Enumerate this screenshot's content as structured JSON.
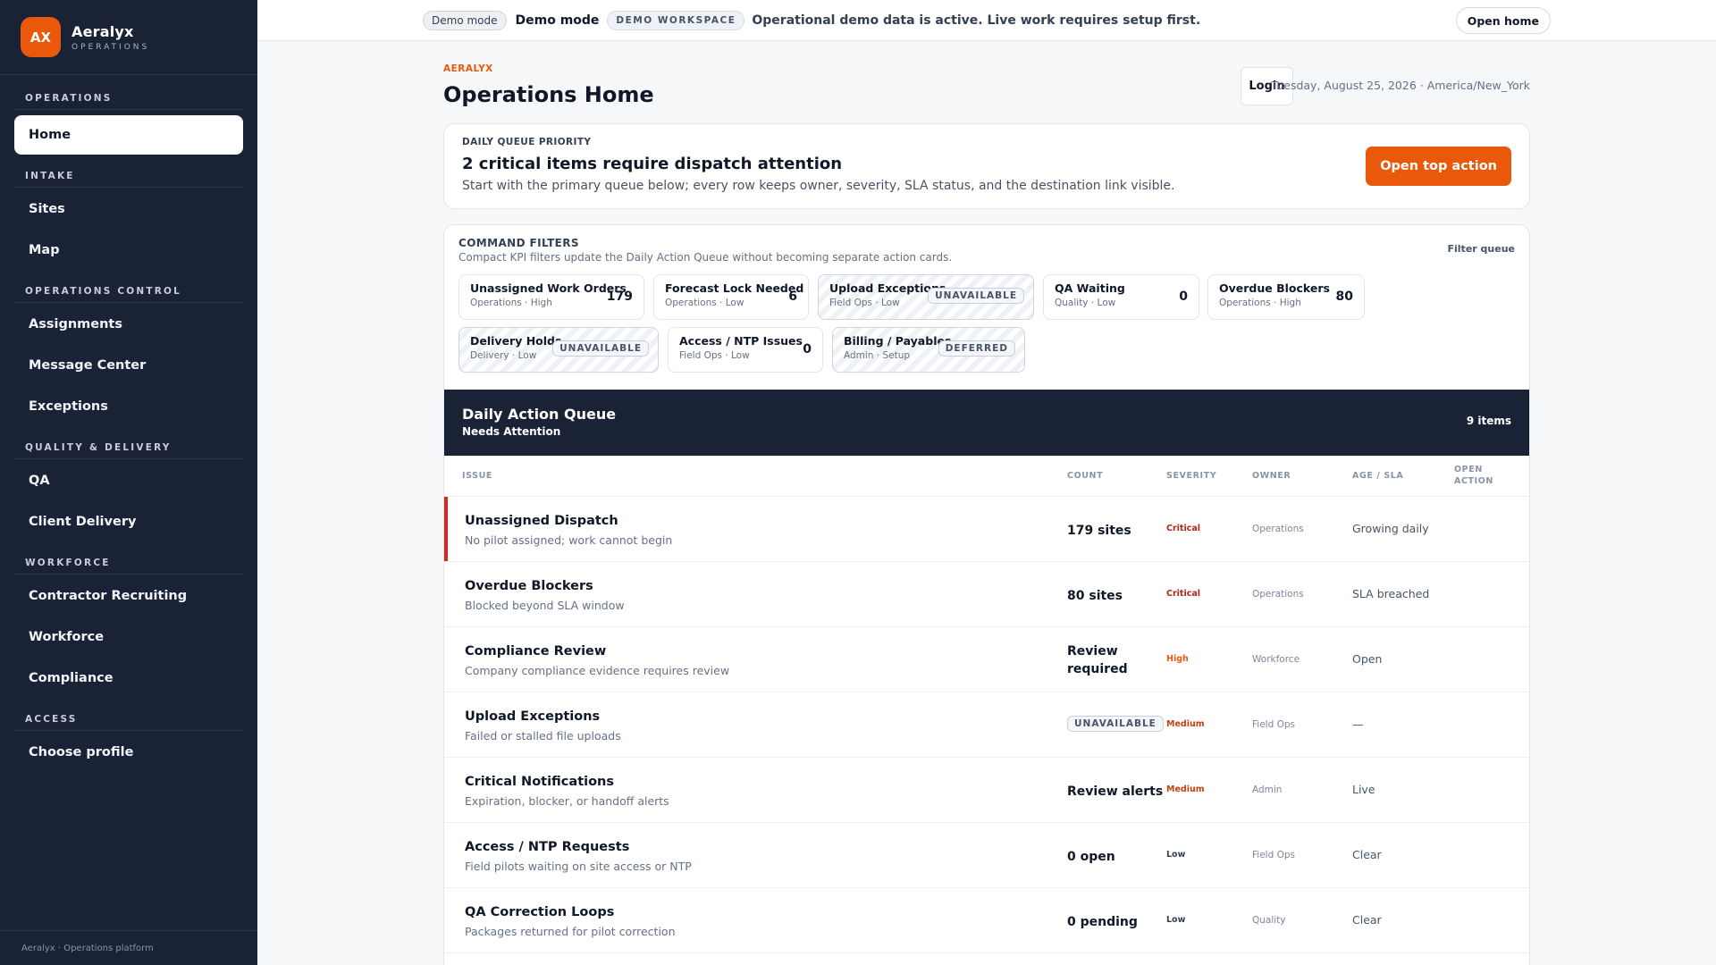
{
  "brand": {
    "logo": "AX",
    "name": "Aeralyx",
    "sub": "OPERATIONS"
  },
  "nav": {
    "operations": {
      "heading": "OPERATIONS",
      "items": [
        "Home"
      ]
    },
    "intake": {
      "heading": "INTAKE",
      "items": [
        "Sites",
        "Map"
      ]
    },
    "ops_control": {
      "heading": "OPERATIONS CONTROL",
      "items": [
        "Assignments",
        "Message Center",
        "Exceptions"
      ]
    },
    "quality": {
      "heading": "QUALITY & DELIVERY",
      "items": [
        "QA",
        "Client Delivery"
      ]
    },
    "workforce": {
      "heading": "WORKFORCE",
      "items": [
        "Contractor Recruiting",
        "Workforce",
        "Compliance"
      ]
    },
    "access": {
      "heading": "ACCESS",
      "items": [
        "Choose profile"
      ]
    },
    "footer": "Aeralyx · Operations platform"
  },
  "topbar": {
    "chip": "Demo mode",
    "title": "Demo mode",
    "workspace": "DEMO WORKSPACE",
    "message": "Operational demo data is active. Live work requires setup first.",
    "open_home": "Open home"
  },
  "header": {
    "eyebrow": "AERALYX",
    "title": "Operations Home",
    "login": "Login",
    "date": "Tuesday, August 25, 2026 · America/New_York"
  },
  "priority": {
    "label": "DAILY QUEUE PRIORITY",
    "title": "2 critical items require dispatch attention",
    "desc": "Start with the primary queue below; every row keeps owner, severity, SLA status, and the destination link visible.",
    "button": "Open top action"
  },
  "filters": {
    "label": "COMMAND FILTERS",
    "desc": "Compact KPI filters update the Daily Action Queue without becoming separate action cards.",
    "link": "Filter queue",
    "kpis": [
      {
        "name": "Unassigned Work Orders",
        "meta": "Operations · High",
        "value": "179"
      },
      {
        "name": "Forecast Lock Needed",
        "meta": "Operations · Low",
        "value": "6"
      },
      {
        "name": "Upload Exceptions",
        "meta": "Field Ops · Low",
        "badge": "UNAVAILABLE"
      },
      {
        "name": "QA Waiting",
        "meta": "Quality · Low",
        "value": "0"
      },
      {
        "name": "Overdue Blockers",
        "meta": "Operations · High",
        "value": "80"
      },
      {
        "name": "Delivery Holds",
        "meta": "Delivery · Low",
        "badge": "UNAVAILABLE"
      },
      {
        "name": "Access / NTP Issues",
        "meta": "Field Ops · Low",
        "value": "0"
      },
      {
        "name": "Billing / Payables",
        "meta": "Admin · Setup",
        "badge": "DEFERRED"
      }
    ]
  },
  "queue": {
    "title": "Daily Action Queue",
    "subtitle": "Needs Attention",
    "count": "9 items",
    "columns": {
      "issue": "ISSUE",
      "count": "COUNT",
      "severity": "SEVERITY",
      "owner": "OWNER",
      "age": "AGE / SLA",
      "open1": "OPEN",
      "open2": "ACTION"
    },
    "rows": [
      {
        "title": "Unassigned Dispatch",
        "sub": "No pilot assigned; work cannot begin",
        "count": "179 sites",
        "severity": "Critical",
        "owner": "Operations",
        "sla": "Growing daily"
      },
      {
        "title": "Overdue Blockers",
        "sub": "Blocked beyond SLA window",
        "count": "80 sites",
        "severity": "Critical",
        "owner": "Operations",
        "sla": "SLA breached"
      },
      {
        "title": "Compliance Review",
        "sub": "Company compliance evidence requires review",
        "count": "Review required",
        "severity": "High",
        "owner": "Workforce",
        "sla": "Open"
      },
      {
        "title": "Upload Exceptions",
        "sub": "Failed or stalled file uploads",
        "count": "UNAVAILABLE",
        "severity": "Medium",
        "owner": "Field Ops",
        "sla": "—"
      },
      {
        "title": "Critical Notifications",
        "sub": "Expiration, blocker, or handoff alerts",
        "count": "Review alerts",
        "severity": "Medium",
        "owner": "Admin",
        "sla": "Live"
      },
      {
        "title": "Access / NTP Requests",
        "sub": "Field pilots waiting on site access or NTP",
        "count": "0 open",
        "severity": "Low",
        "owner": "Field Ops",
        "sla": "Clear"
      },
      {
        "title": "QA Correction Loops",
        "sub": "Packages returned for pilot correction",
        "count": "0 pending",
        "severity": "Low",
        "owner": "Quality",
        "sla": "Clear"
      }
    ]
  },
  "colors": {
    "accent": "#ea580c",
    "sidebar": "#1a2236",
    "critical": "#b42318"
  }
}
